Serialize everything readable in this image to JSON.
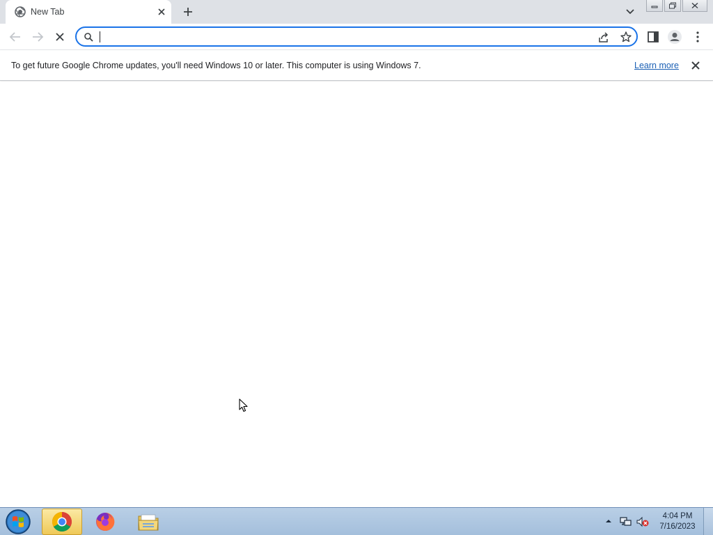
{
  "browser": {
    "tab": {
      "title": "New Tab",
      "favicon": "chrome-newtab-icon",
      "close_icon": "close-icon"
    },
    "new_tab_icon": "plus-icon",
    "tab_search_icon": "chevron-down-icon",
    "window_controls": [
      "minimize-icon",
      "restore-icon",
      "close-icon"
    ]
  },
  "toolbar": {
    "back_icon": "arrow-left-icon",
    "forward_icon": "arrow-right-icon",
    "stop_icon": "stop-x-icon",
    "omnibox": {
      "value": "",
      "placeholder": "",
      "search_icon": "search-icon",
      "share_icon": "share-icon",
      "bookmark_icon": "star-icon"
    },
    "side_panel_icon": "side-panel-icon",
    "profile_icon": "profile-icon",
    "menu_icon": "kebab-menu-icon"
  },
  "infobar": {
    "message": "To get future Google Chrome updates, you'll need Windows 10 or later. This computer is using Windows 7.",
    "link": "Learn more",
    "close_icon": "close-icon"
  },
  "taskbar": {
    "items": [
      "chrome",
      "firefox",
      "file-explorer"
    ],
    "active_item": "chrome",
    "clock": {
      "time": "4:04 PM",
      "date": "7/16/2023"
    }
  },
  "colors": {
    "accent": "#1a73e8",
    "tabstrip": "#dee1e6",
    "link": "#1a5fb4",
    "taskbar": "#a4bfdc"
  }
}
